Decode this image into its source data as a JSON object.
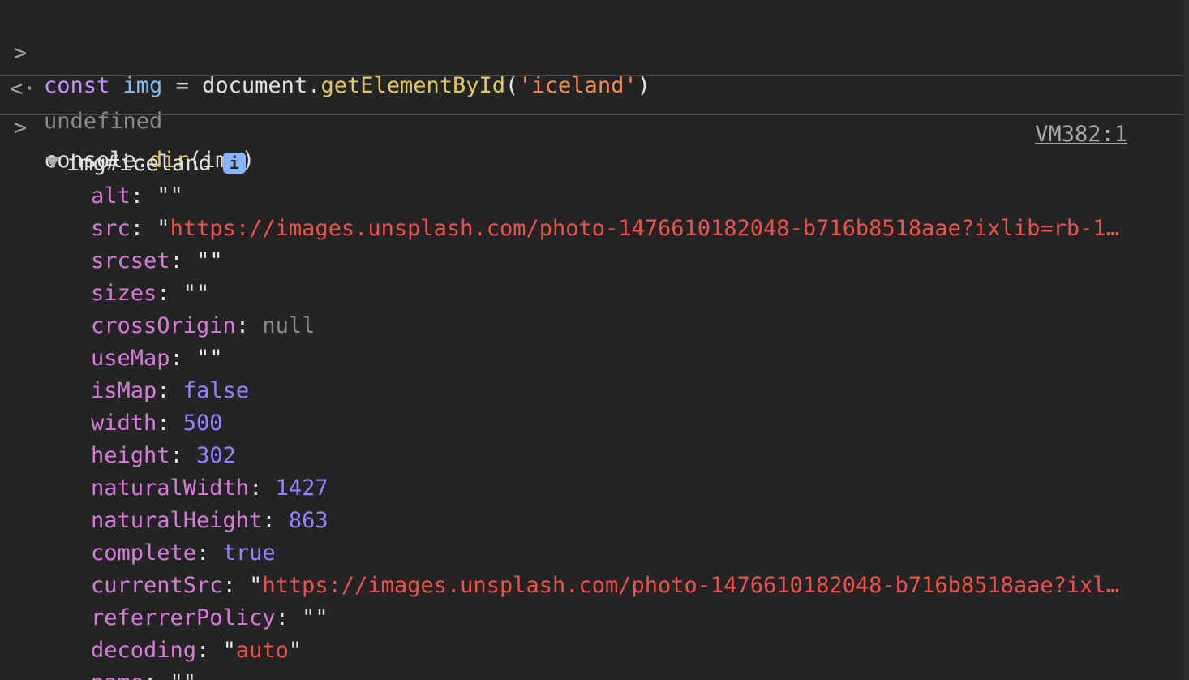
{
  "history": [
    {
      "prompt": ">",
      "tokens": {
        "keyword": "const",
        "variable": "img",
        "operator": "=",
        "object": "document.",
        "method": "getElementById",
        "open_paren": "(",
        "string": "'iceland'",
        "close_paren": ")"
      }
    },
    {
      "prompt": "<·",
      "result": "undefined"
    },
    {
      "prompt": ">",
      "tokens": {
        "object": "console.",
        "method": "dir",
        "args": "(img)"
      }
    }
  ],
  "source_link": "VM382:1",
  "object": {
    "label": "img#iceland",
    "info_badge": "i",
    "properties": [
      {
        "key": "alt",
        "value": "\"\"",
        "type": "plain"
      },
      {
        "key": "src",
        "value": "https://images.unsplash.com/photo-1476610182048-b716b8518aae?ixlib=rb-1…",
        "type": "url"
      },
      {
        "key": "srcset",
        "value": "\"\"",
        "type": "plain"
      },
      {
        "key": "sizes",
        "value": "\"\"",
        "type": "plain"
      },
      {
        "key": "crossOrigin",
        "value": "null",
        "type": "null"
      },
      {
        "key": "useMap",
        "value": "\"\"",
        "type": "plain"
      },
      {
        "key": "isMap",
        "value": "false",
        "type": "bool"
      },
      {
        "key": "width",
        "value": "500",
        "type": "num"
      },
      {
        "key": "height",
        "value": "302",
        "type": "num"
      },
      {
        "key": "naturalWidth",
        "value": "1427",
        "type": "num"
      },
      {
        "key": "naturalHeight",
        "value": "863",
        "type": "num"
      },
      {
        "key": "complete",
        "value": "true",
        "type": "bool"
      },
      {
        "key": "currentSrc",
        "value": "https://images.unsplash.com/photo-1476610182048-b716b8518aae?ixl…",
        "type": "url"
      },
      {
        "key": "referrerPolicy",
        "value": "\"\"",
        "type": "plain"
      },
      {
        "key": "decoding",
        "value": "auto",
        "type": "quoted"
      },
      {
        "key": "name",
        "value": "\"\"",
        "type": "plain"
      }
    ]
  }
}
